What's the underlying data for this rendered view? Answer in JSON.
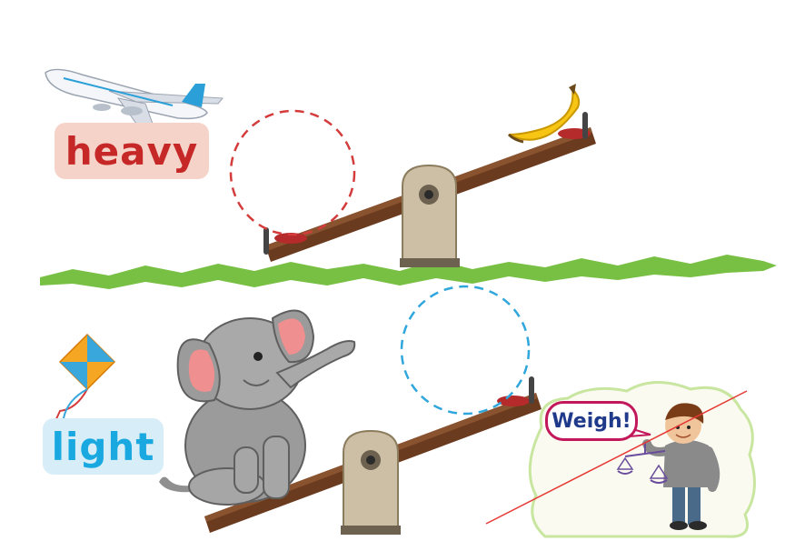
{
  "labels": {
    "heavy": "heavy",
    "light": "light",
    "weigh": "Weigh!"
  },
  "colors": {
    "heavy_text": "#c62828",
    "heavy_bg": "#f6d3c9",
    "light_text": "#19a9e0",
    "light_bg": "#d7eef8",
    "grass": "#78c043",
    "plank": "#6b3b1f",
    "pivot": "#cdbfa5",
    "circle_top": "#d43c3c",
    "circle_bottom": "#2fa6dc",
    "weigh_text": "#1f3a8a",
    "weigh_border": "#c2185b",
    "cloud_border": "#c8e6a0"
  },
  "icons": [
    "airplane-icon",
    "banana-icon",
    "elephant-icon",
    "kite-icon",
    "boy-with-scale-icon"
  ]
}
